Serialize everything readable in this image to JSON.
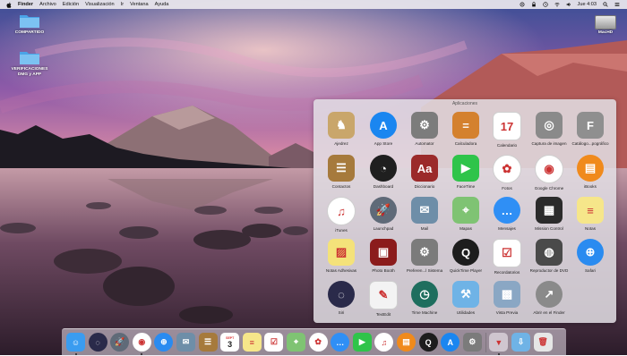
{
  "menubar": {
    "app_name": "Finder",
    "menus": [
      "Archivo",
      "Edición",
      "Visualización",
      "Ir",
      "Ventana",
      "Ayuda"
    ],
    "clock": "Jue 4:03"
  },
  "desktop": {
    "icons": [
      {
        "label": "COMPARTIDO"
      },
      {
        "label": "VERIFICACIONES DMG y APP"
      }
    ],
    "drive_label": "MacHD"
  },
  "launcher": {
    "title": "Aplicaciones",
    "apps": [
      {
        "name": "Ajedrez",
        "icon": "chess-icon",
        "color": "#c9a66b"
      },
      {
        "name": "App Store",
        "icon": "app-store-icon",
        "color": "#1a86f0"
      },
      {
        "name": "Automator",
        "icon": "automator-icon",
        "color": "#7c7c7c"
      },
      {
        "name": "Calculadora",
        "icon": "calculator-icon",
        "color": "#d4812e"
      },
      {
        "name": "Calendario",
        "icon": "calendar-icon",
        "color": "#ffffff"
      },
      {
        "name": "Captura de imagen",
        "icon": "image-capture-icon",
        "color": "#8a8a8a"
      },
      {
        "name": "Catálogo...pográfico",
        "icon": "font-book-icon",
        "color": "#8f8f8f"
      },
      {
        "name": "Contactos",
        "icon": "contacts-icon",
        "color": "#a67a3c"
      },
      {
        "name": "Dashboard",
        "icon": "dashboard-icon",
        "color": "#1f1f1f"
      },
      {
        "name": "Diccionario",
        "icon": "dictionary-icon",
        "color": "#9b2a2a"
      },
      {
        "name": "FaceTime",
        "icon": "facetime-icon",
        "color": "#2fc44a"
      },
      {
        "name": "Fotos",
        "icon": "photos-icon",
        "color": "#ffffff"
      },
      {
        "name": "Google Chrome",
        "icon": "chrome-icon",
        "color": "#ffffff"
      },
      {
        "name": "iBooks",
        "icon": "ibooks-icon",
        "color": "#f08a1c"
      },
      {
        "name": "iTunes",
        "icon": "itunes-icon",
        "color": "#ffffff"
      },
      {
        "name": "Launchpad",
        "icon": "launchpad-icon",
        "color": "#5f6a78"
      },
      {
        "name": "Mail",
        "icon": "mail-icon",
        "color": "#6e8ea8"
      },
      {
        "name": "Mapas",
        "icon": "maps-icon",
        "color": "#7fc373"
      },
      {
        "name": "Mensajes",
        "icon": "messages-icon",
        "color": "#2f8ff5"
      },
      {
        "name": "Mission Control",
        "icon": "mission-control-icon",
        "color": "#2b2b2b"
      },
      {
        "name": "Notas",
        "icon": "notes-icon",
        "color": "#f6e68a"
      },
      {
        "name": "Notas Adhesivas",
        "icon": "stickies-icon",
        "color": "#f4e27a"
      },
      {
        "name": "Photo Booth",
        "icon": "photo-booth-icon",
        "color": "#8b1c1c"
      },
      {
        "name": "Preferen...l Sistema",
        "icon": "system-preferences-icon",
        "color": "#7b7b7b"
      },
      {
        "name": "QuickTime Player",
        "icon": "quicktime-icon",
        "color": "#1d1d1d"
      },
      {
        "name": "Recordatorios",
        "icon": "reminders-icon",
        "color": "#ffffff"
      },
      {
        "name": "Reproductor de DVD",
        "icon": "dvd-player-icon",
        "color": "#4a4a4a"
      },
      {
        "name": "Safari",
        "icon": "safari-icon",
        "color": "#2a8bf0"
      },
      {
        "name": "Siri",
        "icon": "siri-icon",
        "color": "#2a2a4a"
      },
      {
        "name": "TextEdit",
        "icon": "textedit-icon",
        "color": "#f3f3f3"
      },
      {
        "name": "Time Machine",
        "icon": "time-machine-icon",
        "color": "#1e6e5e"
      },
      {
        "name": "Utilidades",
        "icon": "utilities-folder-icon",
        "color": "#6fb3e6"
      },
      {
        "name": "Vista Previa",
        "icon": "preview-icon",
        "color": "#8aa7c4"
      },
      {
        "name": "Abrir en el Finder",
        "icon": "open-in-finder-icon",
        "color": "#8a8a8a"
      }
    ]
  },
  "dock": {
    "items": [
      {
        "name": "finder-icon",
        "color": "#3a9cf0"
      },
      {
        "name": "siri-icon",
        "color": "#2a2a4a"
      },
      {
        "name": "launchpad-icon",
        "color": "#5f6a78"
      },
      {
        "name": "chrome-icon",
        "color": "#ffffff"
      },
      {
        "name": "safari-icon",
        "color": "#2a8bf0"
      },
      {
        "name": "mail-stamp-icon",
        "color": "#6e8ea8"
      },
      {
        "name": "contacts-icon",
        "color": "#a67a3c"
      },
      {
        "name": "calendar-icon",
        "color": "#ffffff"
      },
      {
        "name": "notes-icon",
        "color": "#f6e68a"
      },
      {
        "name": "reminders-icon",
        "color": "#ffffff"
      },
      {
        "name": "maps-icon",
        "color": "#7fc373"
      },
      {
        "name": "photos-icon",
        "color": "#ffffff"
      },
      {
        "name": "messages-icon",
        "color": "#2f8ff5"
      },
      {
        "name": "facetime-icon",
        "color": "#2fc44a"
      },
      {
        "name": "itunes-icon",
        "color": "#ffffff"
      },
      {
        "name": "ibooks-icon",
        "color": "#f08a1c"
      },
      {
        "name": "quicktime-icon",
        "color": "#1d1d1d"
      },
      {
        "name": "app-store-icon",
        "color": "#1a86f0"
      },
      {
        "name": "system-preferences-icon",
        "color": "#7b7b7b"
      },
      {
        "name": "applications-stack-icon",
        "color": "#cfc6cf"
      },
      {
        "name": "downloads-folder-icon",
        "color": "#6fb3e6"
      },
      {
        "name": "trash-icon",
        "color": "#e6e6e6"
      }
    ],
    "calendar_day": "3",
    "calendar_month": "SEPT"
  }
}
